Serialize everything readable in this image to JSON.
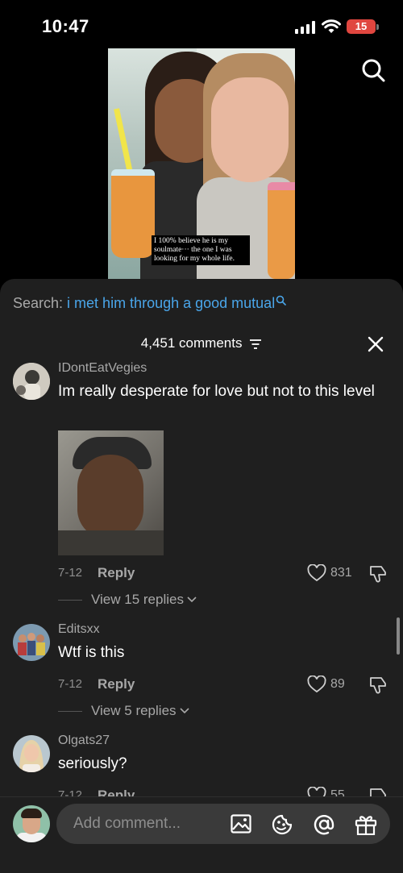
{
  "status_bar": {
    "time": "10:47",
    "battery": "15"
  },
  "video": {
    "caption": "I 100% believe he is my soulmate··· the one I was looking for my whole life."
  },
  "search": {
    "prefix": "Search: ",
    "query": "i met him through a good mutual"
  },
  "comments_header": {
    "count_label": "4,451 comments"
  },
  "comments": [
    {
      "username": "IDontEatVegies",
      "text": "Im really desperate for love but not to this level",
      "date": "7-12",
      "reply_label": "Reply",
      "likes": "831",
      "view_replies": "View 15 replies",
      "has_gif": true
    },
    {
      "username": "Editsxx",
      "text": "Wtf is this",
      "date": "7-12",
      "reply_label": "Reply",
      "likes": "89",
      "view_replies": "View 5 replies"
    },
    {
      "username": "Olgats27",
      "text": "seriously?",
      "date": "7-12",
      "reply_label": "Reply",
      "likes": "55"
    }
  ],
  "bottom_bar": {
    "placeholder": "Add comment..."
  },
  "icons": [
    "search-icon",
    "filter-icon",
    "close-icon",
    "heart-icon",
    "dislike-icon",
    "chevron-down-icon",
    "image-icon",
    "emoji-icon",
    "at-icon",
    "gift-icon"
  ],
  "colors": {
    "accent_link": "#4aa6ea",
    "sheet_bg": "#1f1f1f",
    "battery": "#e0463f"
  }
}
